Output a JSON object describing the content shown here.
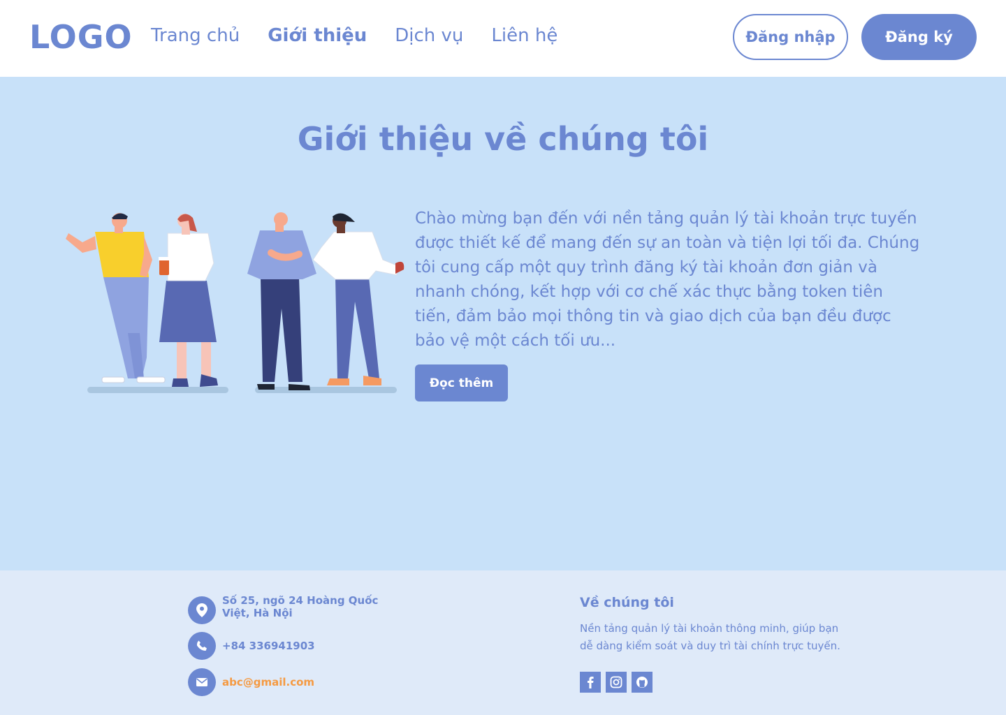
{
  "header": {
    "logo": "LOGO",
    "nav": [
      {
        "label": "Trang chủ"
      },
      {
        "label": "Giới thiệu"
      },
      {
        "label": "Dịch vụ"
      },
      {
        "label": "Liên hệ"
      }
    ],
    "login_label": "Đăng nhập",
    "signup_label": "Đăng ký"
  },
  "hero": {
    "title": "Giới thiệu về chúng tôi",
    "paragraph": "Chào mừng bạn đến với nền tảng quản lý tài khoản trực tuyến được thiết kế để mang đến sự an toàn và tiện lợi tối đa. Chúng tôi cung cấp một quy trình đăng ký tài khoản đơn giản và nhanh chóng, kết hợp với cơ chế xác thực bằng token tiên tiến, đảm bảo mọi thông tin và giao dịch của bạn đều được bảo vệ một cách tối ưu...",
    "read_more_label": "Đọc thêm",
    "illustration": "people-talking-illustration"
  },
  "footer": {
    "address": "Số 25,  ngõ 24 Hoàng Quốc Việt, Hà Nội",
    "phone": "+84 336941903",
    "email": "abc@gmail.com",
    "about_title": "Về chúng tôi",
    "about_text": "Nền tảng quản lý tài khoản thông minh, giúp bạn dễ dàng kiểm soát và duy trì tài chính trực tuyến.",
    "icons": [
      "location-icon",
      "phone-icon",
      "mail-icon"
    ],
    "socials": [
      "facebook-icon",
      "instagram-icon",
      "github-icon"
    ]
  },
  "colors": {
    "accent": "#6b87d1",
    "hero_bg": "#c8e1f9",
    "footer_bg": "#dfeaf9",
    "email": "#f59a42"
  }
}
